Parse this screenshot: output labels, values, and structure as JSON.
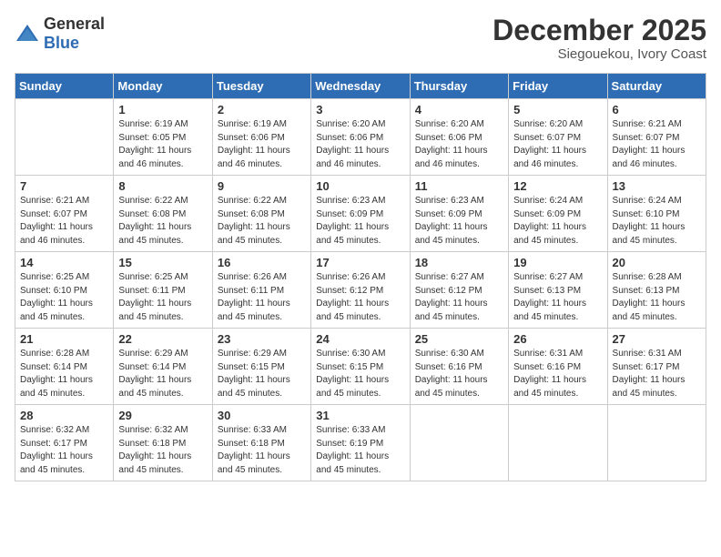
{
  "logo": {
    "general": "General",
    "blue": "Blue"
  },
  "header": {
    "month": "December 2025",
    "location": "Siegouekou, Ivory Coast"
  },
  "weekdays": [
    "Sunday",
    "Monday",
    "Tuesday",
    "Wednesday",
    "Thursday",
    "Friday",
    "Saturday"
  ],
  "weeks": [
    [
      {
        "day": "",
        "info": ""
      },
      {
        "day": "1",
        "info": "Sunrise: 6:19 AM\nSunset: 6:05 PM\nDaylight: 11 hours\nand 46 minutes."
      },
      {
        "day": "2",
        "info": "Sunrise: 6:19 AM\nSunset: 6:06 PM\nDaylight: 11 hours\nand 46 minutes."
      },
      {
        "day": "3",
        "info": "Sunrise: 6:20 AM\nSunset: 6:06 PM\nDaylight: 11 hours\nand 46 minutes."
      },
      {
        "day": "4",
        "info": "Sunrise: 6:20 AM\nSunset: 6:06 PM\nDaylight: 11 hours\nand 46 minutes."
      },
      {
        "day": "5",
        "info": "Sunrise: 6:20 AM\nSunset: 6:07 PM\nDaylight: 11 hours\nand 46 minutes."
      },
      {
        "day": "6",
        "info": "Sunrise: 6:21 AM\nSunset: 6:07 PM\nDaylight: 11 hours\nand 46 minutes."
      }
    ],
    [
      {
        "day": "7",
        "info": "Sunrise: 6:21 AM\nSunset: 6:07 PM\nDaylight: 11 hours\nand 46 minutes."
      },
      {
        "day": "8",
        "info": "Sunrise: 6:22 AM\nSunset: 6:08 PM\nDaylight: 11 hours\nand 45 minutes."
      },
      {
        "day": "9",
        "info": "Sunrise: 6:22 AM\nSunset: 6:08 PM\nDaylight: 11 hours\nand 45 minutes."
      },
      {
        "day": "10",
        "info": "Sunrise: 6:23 AM\nSunset: 6:09 PM\nDaylight: 11 hours\nand 45 minutes."
      },
      {
        "day": "11",
        "info": "Sunrise: 6:23 AM\nSunset: 6:09 PM\nDaylight: 11 hours\nand 45 minutes."
      },
      {
        "day": "12",
        "info": "Sunrise: 6:24 AM\nSunset: 6:09 PM\nDaylight: 11 hours\nand 45 minutes."
      },
      {
        "day": "13",
        "info": "Sunrise: 6:24 AM\nSunset: 6:10 PM\nDaylight: 11 hours\nand 45 minutes."
      }
    ],
    [
      {
        "day": "14",
        "info": "Sunrise: 6:25 AM\nSunset: 6:10 PM\nDaylight: 11 hours\nand 45 minutes."
      },
      {
        "day": "15",
        "info": "Sunrise: 6:25 AM\nSunset: 6:11 PM\nDaylight: 11 hours\nand 45 minutes."
      },
      {
        "day": "16",
        "info": "Sunrise: 6:26 AM\nSunset: 6:11 PM\nDaylight: 11 hours\nand 45 minutes."
      },
      {
        "day": "17",
        "info": "Sunrise: 6:26 AM\nSunset: 6:12 PM\nDaylight: 11 hours\nand 45 minutes."
      },
      {
        "day": "18",
        "info": "Sunrise: 6:27 AM\nSunset: 6:12 PM\nDaylight: 11 hours\nand 45 minutes."
      },
      {
        "day": "19",
        "info": "Sunrise: 6:27 AM\nSunset: 6:13 PM\nDaylight: 11 hours\nand 45 minutes."
      },
      {
        "day": "20",
        "info": "Sunrise: 6:28 AM\nSunset: 6:13 PM\nDaylight: 11 hours\nand 45 minutes."
      }
    ],
    [
      {
        "day": "21",
        "info": "Sunrise: 6:28 AM\nSunset: 6:14 PM\nDaylight: 11 hours\nand 45 minutes."
      },
      {
        "day": "22",
        "info": "Sunrise: 6:29 AM\nSunset: 6:14 PM\nDaylight: 11 hours\nand 45 minutes."
      },
      {
        "day": "23",
        "info": "Sunrise: 6:29 AM\nSunset: 6:15 PM\nDaylight: 11 hours\nand 45 minutes."
      },
      {
        "day": "24",
        "info": "Sunrise: 6:30 AM\nSunset: 6:15 PM\nDaylight: 11 hours\nand 45 minutes."
      },
      {
        "day": "25",
        "info": "Sunrise: 6:30 AM\nSunset: 6:16 PM\nDaylight: 11 hours\nand 45 minutes."
      },
      {
        "day": "26",
        "info": "Sunrise: 6:31 AM\nSunset: 6:16 PM\nDaylight: 11 hours\nand 45 minutes."
      },
      {
        "day": "27",
        "info": "Sunrise: 6:31 AM\nSunset: 6:17 PM\nDaylight: 11 hours\nand 45 minutes."
      }
    ],
    [
      {
        "day": "28",
        "info": "Sunrise: 6:32 AM\nSunset: 6:17 PM\nDaylight: 11 hours\nand 45 minutes."
      },
      {
        "day": "29",
        "info": "Sunrise: 6:32 AM\nSunset: 6:18 PM\nDaylight: 11 hours\nand 45 minutes."
      },
      {
        "day": "30",
        "info": "Sunrise: 6:33 AM\nSunset: 6:18 PM\nDaylight: 11 hours\nand 45 minutes."
      },
      {
        "day": "31",
        "info": "Sunrise: 6:33 AM\nSunset: 6:19 PM\nDaylight: 11 hours\nand 45 minutes."
      },
      {
        "day": "",
        "info": ""
      },
      {
        "day": "",
        "info": ""
      },
      {
        "day": "",
        "info": ""
      }
    ]
  ]
}
